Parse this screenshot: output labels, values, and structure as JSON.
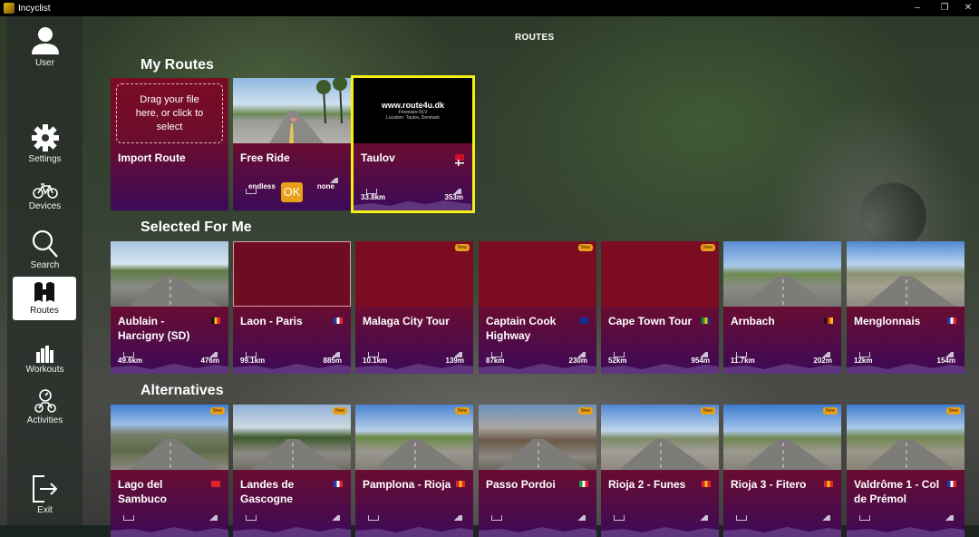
{
  "window": {
    "title": "Incyclist",
    "min": "–",
    "restore": "❐",
    "close": "✕"
  },
  "sidebar": {
    "items": [
      {
        "key": "user",
        "label": "User",
        "icon": "user-icon"
      },
      {
        "key": "settings",
        "label": "Settings",
        "icon": "gear-icon"
      },
      {
        "key": "devices",
        "label": "Devices",
        "icon": "bicycle-icon"
      },
      {
        "key": "search",
        "label": "Search",
        "icon": "search-icon"
      },
      {
        "key": "routes",
        "label": "Routes",
        "icon": "routes-icon",
        "active": true
      },
      {
        "key": "workouts",
        "label": "Workouts",
        "icon": "workouts-icon"
      },
      {
        "key": "activities",
        "label": "Activities",
        "icon": "activities-icon"
      },
      {
        "key": "exit",
        "label": "Exit",
        "icon": "exit-icon"
      }
    ]
  },
  "page": {
    "title": "ROUTES"
  },
  "my_routes": {
    "title": "My Routes",
    "import": {
      "drop_text": "Drag your file here, or click to select",
      "name": "Import Route"
    },
    "free_ride": {
      "name": "Free Ride",
      "duration": "endless",
      "ok": "OK",
      "elevation": "none"
    },
    "taulov": {
      "name": "Taulov",
      "distance": "33.8km",
      "elevation": "353m",
      "img_line1": "www.route4u.dk",
      "img_line2": "Freeware RLV",
      "img_line3": "Location: Taulov, Denmark",
      "flag": "dk"
    }
  },
  "selected": {
    "title": "Selected For Me",
    "cards": [
      {
        "name": "Aublain - Harcigny (SD)",
        "distance": "49.6km",
        "elevation": "476m",
        "flag": "be",
        "badge": ""
      },
      {
        "name": "Laon - Paris",
        "distance": "99.1km",
        "elevation": "885m",
        "flag": "fr",
        "badge": ""
      },
      {
        "name": "Malaga City Tour",
        "distance": "10.1km",
        "elevation": "139m",
        "flag": "",
        "badge": "New"
      },
      {
        "name": "Captain Cook Highway",
        "distance": "87km",
        "elevation": "230m",
        "flag": "au",
        "badge": "New"
      },
      {
        "name": "Cape Town Tour",
        "distance": "52km",
        "elevation": "954m",
        "flag": "za",
        "badge": "New"
      },
      {
        "name": "Arnbach",
        "distance": "11.7km",
        "elevation": "202m",
        "flag": "de",
        "badge": ""
      },
      {
        "name": "Menglonnais",
        "distance": "12km",
        "elevation": "154m",
        "flag": "fr",
        "badge": ""
      }
    ]
  },
  "alternatives": {
    "title": "Alternatives",
    "cards": [
      {
        "name": "Lago del Sambuco",
        "flag": "ch",
        "badge": "New"
      },
      {
        "name": "Landes de Gascogne",
        "flag": "fr",
        "badge": "New"
      },
      {
        "name": "Pamplona - Rioja",
        "flag": "es",
        "badge": "New"
      },
      {
        "name": "Passo Pordoi",
        "flag": "it",
        "badge": "New"
      },
      {
        "name": "Rioja 2 - Funes",
        "flag": "es",
        "badge": "New"
      },
      {
        "name": "Rioja 3 - Fitero",
        "flag": "es",
        "badge": "New"
      },
      {
        "name": "Valdrôme 1 - Col de Prémol",
        "flag": "fr",
        "badge": "New"
      }
    ]
  },
  "colors": {
    "card_top": "#7b0c22",
    "card_bottom": "#3c0a58",
    "selected_outline": "#f5f014",
    "ok": "#e8a018"
  }
}
